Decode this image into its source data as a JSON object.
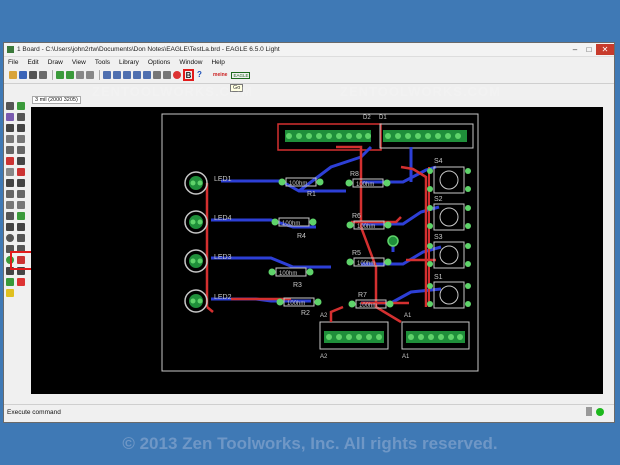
{
  "window": {
    "title": "1 Board - C:\\Users\\john2rtw\\Documents\\Don Notes\\EAGLE\\TestLa.brd - EAGLE 6.5.0 Light",
    "min": "–",
    "max": "□",
    "close": "✕"
  },
  "menu": [
    "File",
    "Edit",
    "Draw",
    "View",
    "Tools",
    "Library",
    "Options",
    "Window",
    "Help"
  ],
  "toolbar": {
    "go_label": "B",
    "tooltip": "Go",
    "help_label": "?"
  },
  "coordinate_display": "3 mil (2000 3205)",
  "watermark": {
    "top_left": "ZENTOOLWORKS.COM",
    "top_right": "ZENTOOLWORKS.COM"
  },
  "board": {
    "leds": [
      "LED1",
      "LED4",
      "LED3",
      "LED2"
    ],
    "resistors": [
      {
        "value": "100hm",
        "name": "R1"
      },
      {
        "value": "100hm",
        "name": "R4"
      },
      {
        "value": "100hm",
        "name": "R3"
      },
      {
        "value": "100hm",
        "name": "R2"
      },
      {
        "value": "100hm",
        "name": "R8"
      },
      {
        "value": "100hm",
        "name": "R6"
      },
      {
        "value": "100hm",
        "name": "R5"
      },
      {
        "value": "100hm",
        "name": "R7"
      }
    ],
    "switches": [
      "S4",
      "S2",
      "S3",
      "S1"
    ],
    "headers": [
      "D2",
      "D1",
      "A2",
      "A1"
    ]
  },
  "status": {
    "text": "Execute command"
  },
  "footer": {
    "copyright": "© 2013 Zen Toolworks, Inc. All rights reserved."
  },
  "colors": {
    "trace_top": "#d43030",
    "trace_bottom": "#2d3fd6",
    "pad": "#26b24a",
    "silk": "#c8c8c8",
    "accent": "#e21b1b"
  }
}
